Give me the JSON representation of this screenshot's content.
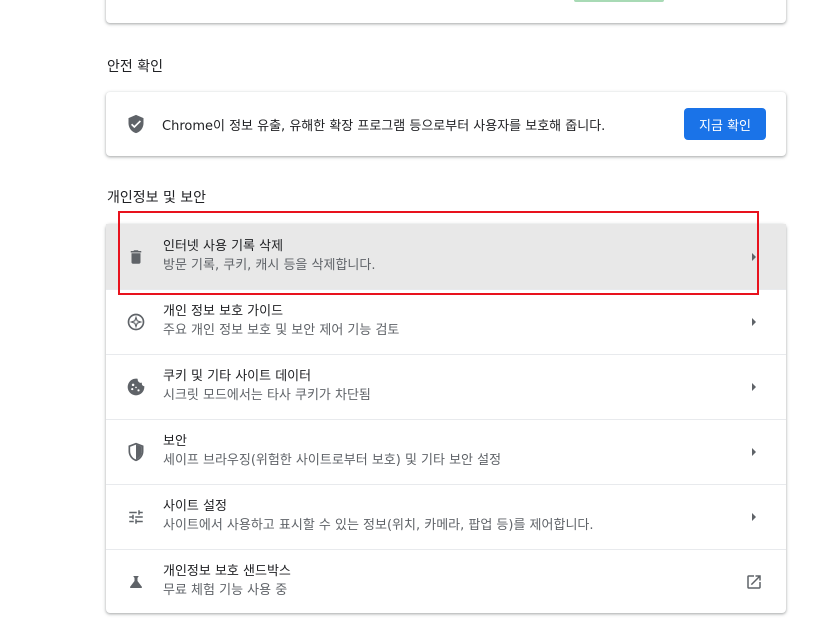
{
  "colors": {
    "accent": "#1a73e8",
    "icon": "#5f6368",
    "highlight_border": "#e8121d",
    "hovered_row": "#e8e8e8"
  },
  "safety_check": {
    "section_title": "안전 확인",
    "icon": "shield-check-icon",
    "description": "Chrome이 정보 유출, 유해한 확장 프로그램 등으로부터 사용자를 보호해 줍니다.",
    "button_label": "지금 확인"
  },
  "privacy": {
    "section_title": "개인정보 및 보안",
    "items": [
      {
        "icon": "trash-icon",
        "title": "인터넷 사용 기록 삭제",
        "subtitle": "방문 기록, 쿠키, 캐시 등을 삭제합니다.",
        "trailing": "chevron-right-icon"
      },
      {
        "icon": "compass-plus-icon",
        "title": "개인 정보 보호 가이드",
        "subtitle": "주요 개인 정보 보호 및 보안 제어 기능 검토",
        "trailing": "chevron-right-icon"
      },
      {
        "icon": "cookie-icon",
        "title": "쿠키 및 기타 사이트 데이터",
        "subtitle": "시크릿 모드에서는 타사 쿠키가 차단됨",
        "trailing": "chevron-right-icon"
      },
      {
        "icon": "shield-icon",
        "title": "보안",
        "subtitle": "세이프 브라우징(위험한 사이트로부터 보호) 및 기타 보안 설정",
        "trailing": "chevron-right-icon"
      },
      {
        "icon": "tune-icon",
        "title": "사이트 설정",
        "subtitle": "사이트에서 사용하고 표시할 수 있는 정보(위치, 카메라, 팝업 등)를 제어합니다.",
        "trailing": "chevron-right-icon"
      },
      {
        "icon": "flask-icon",
        "title": "개인정보 보호 샌드박스",
        "subtitle": "무료 체험 기능 사용 중",
        "trailing": "open-in-new-icon"
      }
    ]
  }
}
